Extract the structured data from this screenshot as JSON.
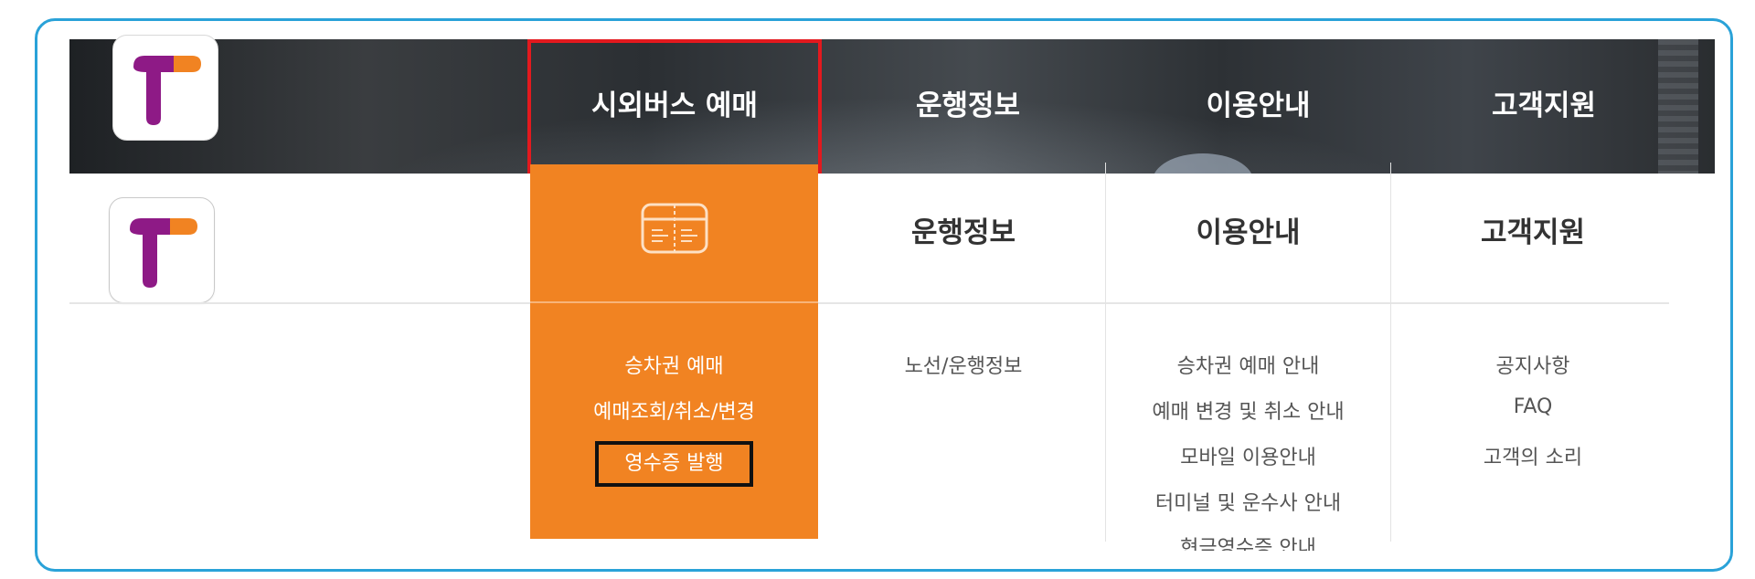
{
  "nav": {
    "items": [
      {
        "label": "시외버스 예매",
        "active": true
      },
      {
        "label": "운행정보"
      },
      {
        "label": "이용안내"
      },
      {
        "label": "고객지원"
      }
    ]
  },
  "dropdown": {
    "columns": [
      {
        "title_icon": "ticket-icon",
        "links": [
          "승차권 예매",
          "예매조회/취소/변경",
          "영수증 발행"
        ]
      },
      {
        "title": "운행정보",
        "links": [
          "노선/운행정보"
        ]
      },
      {
        "title": "이용안내",
        "links": [
          "승차권 예매 안내",
          "예매 변경 및 취소 안내",
          "모바일 이용안내",
          "터미널 및 운수사 안내",
          "현금영수증 안내"
        ]
      },
      {
        "title": "고객지원",
        "links": [
          "공지사항",
          "FAQ",
          "고객의 소리"
        ]
      }
    ]
  },
  "colors": {
    "frame_border": "#2aa2d8",
    "accent_orange": "#f18322",
    "active_outline": "#e3191e",
    "logo_purple": "#8e1a86",
    "logo_orange": "#f18322"
  },
  "icons": {
    "logo": "t-logo-icon",
    "ticket": "ticket-icon"
  }
}
